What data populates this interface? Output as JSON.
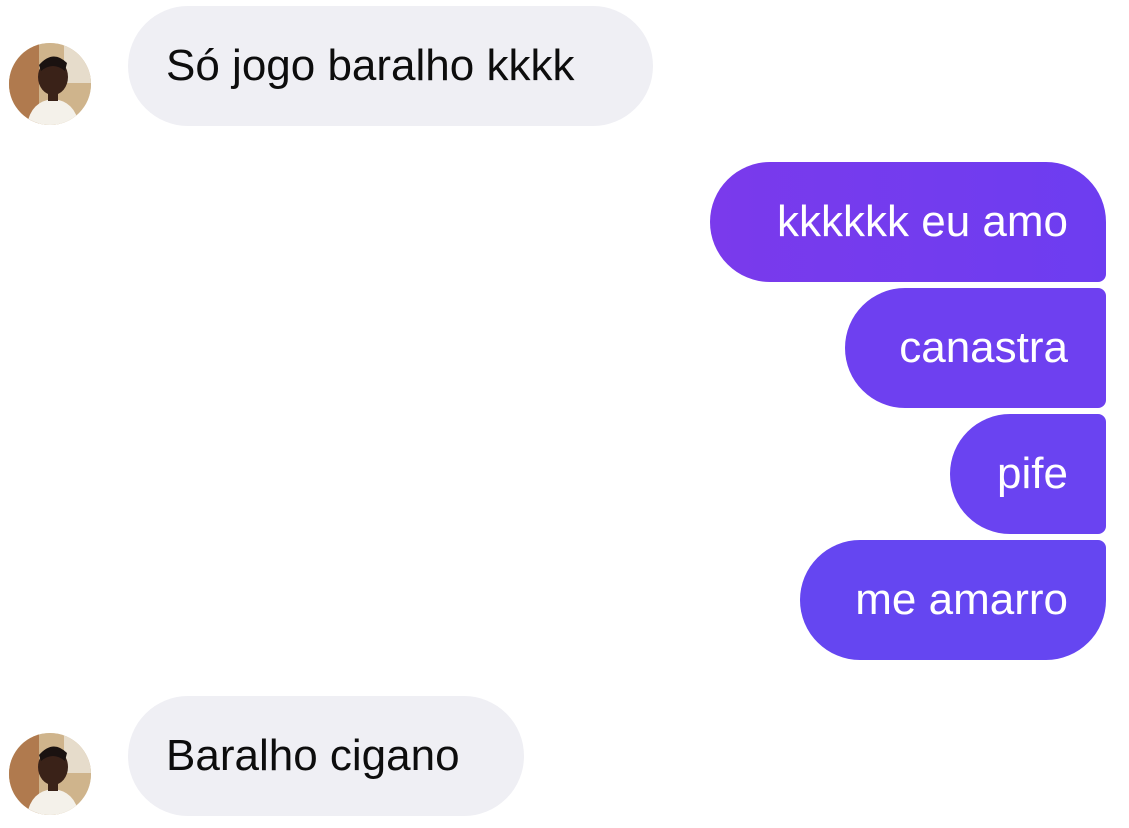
{
  "conversation": {
    "messages": [
      {
        "from": "contact",
        "text": "Só jogo baralho kkkk"
      },
      {
        "from": "me",
        "text": "kkkkkk eu amo"
      },
      {
        "from": "me",
        "text": "canastra"
      },
      {
        "from": "me",
        "text": "pife"
      },
      {
        "from": "me",
        "text": "me amarro"
      },
      {
        "from": "contact",
        "text": "Baralho cigano"
      }
    ]
  },
  "theme": {
    "incoming_bubble": "#efeff4",
    "outgoing_gradient": [
      "#7a3aec",
      "#6546f1"
    ],
    "outgoing_text": "#ffffff",
    "incoming_text": "#0d0d0d"
  },
  "icons": {
    "contact_avatar": "profile-photo"
  }
}
